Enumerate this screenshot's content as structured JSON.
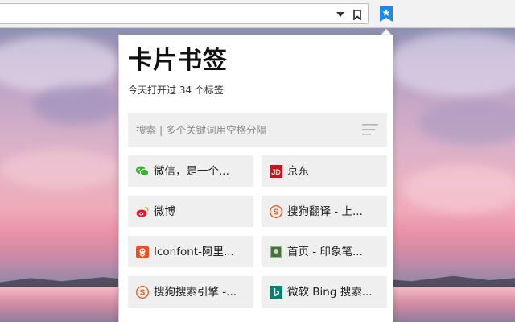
{
  "toolbar": {
    "icons": [
      "chevron-down-icon",
      "bookmark-icon",
      "bookmark-star-extension-icon"
    ],
    "accent_color": "#1e88e5"
  },
  "popup": {
    "title": "卡片书签",
    "subtitle": "今天打开过 34 个标签",
    "search": {
      "placeholder": "搜索 | 多个关键词用空格分隔",
      "value": ""
    },
    "bookmarks": [
      {
        "label": "微信，是一个...",
        "icon": "wechat-icon"
      },
      {
        "label": "京东",
        "icon": "jd-icon"
      },
      {
        "label": "微博",
        "icon": "weibo-icon"
      },
      {
        "label": "搜狗翻译 - 上...",
        "icon": "sogou-icon"
      },
      {
        "label": "Iconfont-阿里...",
        "icon": "iconfont-icon"
      },
      {
        "label": "首页 - 印象笔...",
        "icon": "evernote-icon"
      },
      {
        "label": "搜狗搜索引擎 -...",
        "icon": "sogou-icon"
      },
      {
        "label": "微软 Bing 搜索...",
        "icon": "bing-icon"
      }
    ]
  },
  "colors": {
    "card_bg": "#efefef",
    "wechat": "#3cb034",
    "jd": "#c9151e",
    "sogou": "#f15a22",
    "iconfont": "#e8531f",
    "bing": "#008373"
  }
}
